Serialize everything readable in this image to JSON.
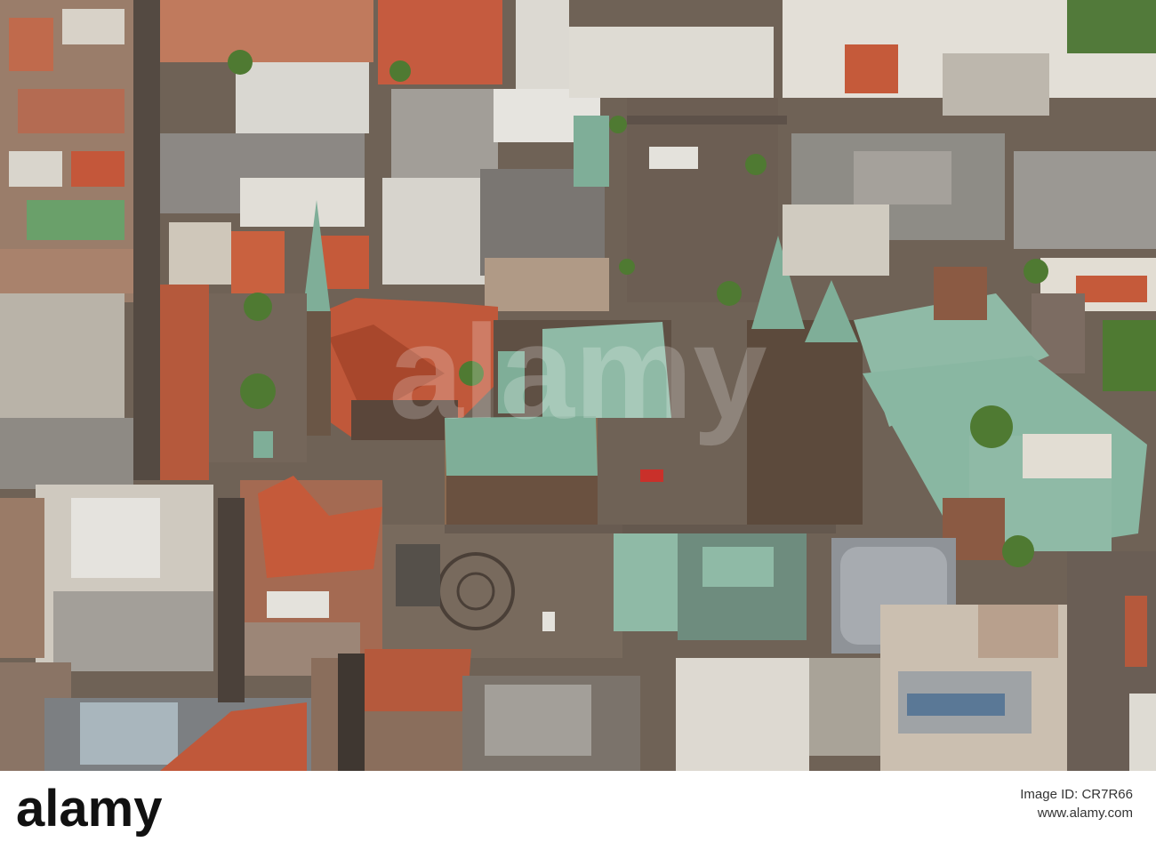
{
  "photo": {
    "subject": "aerial-city-center",
    "colors": {
      "pavement": "#6f6256",
      "red_roof": "#c0583a",
      "copper_roof": "#7fae98",
      "white_roof": "#e4e2dc",
      "grey_roof": "#8a8a88",
      "trees": "#4f7a32"
    }
  },
  "watermark": {
    "text": "alamy"
  },
  "stock_bar": {
    "logo_text": "alamy",
    "image_id_label": "Image ID:",
    "image_id": "CR7R66",
    "url": "www.alamy.com"
  }
}
